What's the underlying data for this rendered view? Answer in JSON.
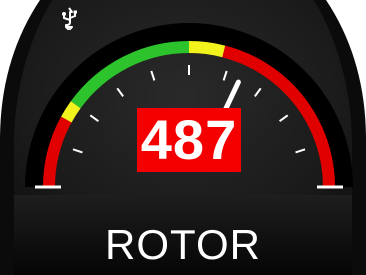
{
  "gauge": {
    "value": "487",
    "label": "ROTOR",
    "needle_fraction": 0.64,
    "scale": {
      "bands": [
        {
          "from": 0.0,
          "to": 0.16,
          "color": "#e00000"
        },
        {
          "from": 0.16,
          "to": 0.2,
          "color": "#f2f21c"
        },
        {
          "from": 0.2,
          "to": 0.5,
          "color": "#2cc32c"
        },
        {
          "from": 0.5,
          "to": 0.58,
          "color": "#f2f21c"
        },
        {
          "from": 0.58,
          "to": 1.0,
          "color": "#e00000"
        }
      ],
      "tick_count": 10
    }
  },
  "icons": {
    "usb": "usb-icon"
  },
  "colors": {
    "panel": "#1c1c1c",
    "bezel": "#0a0a0a",
    "readout_bg": "#f50000",
    "text": "#ffffff",
    "needle": "#ffffff"
  }
}
